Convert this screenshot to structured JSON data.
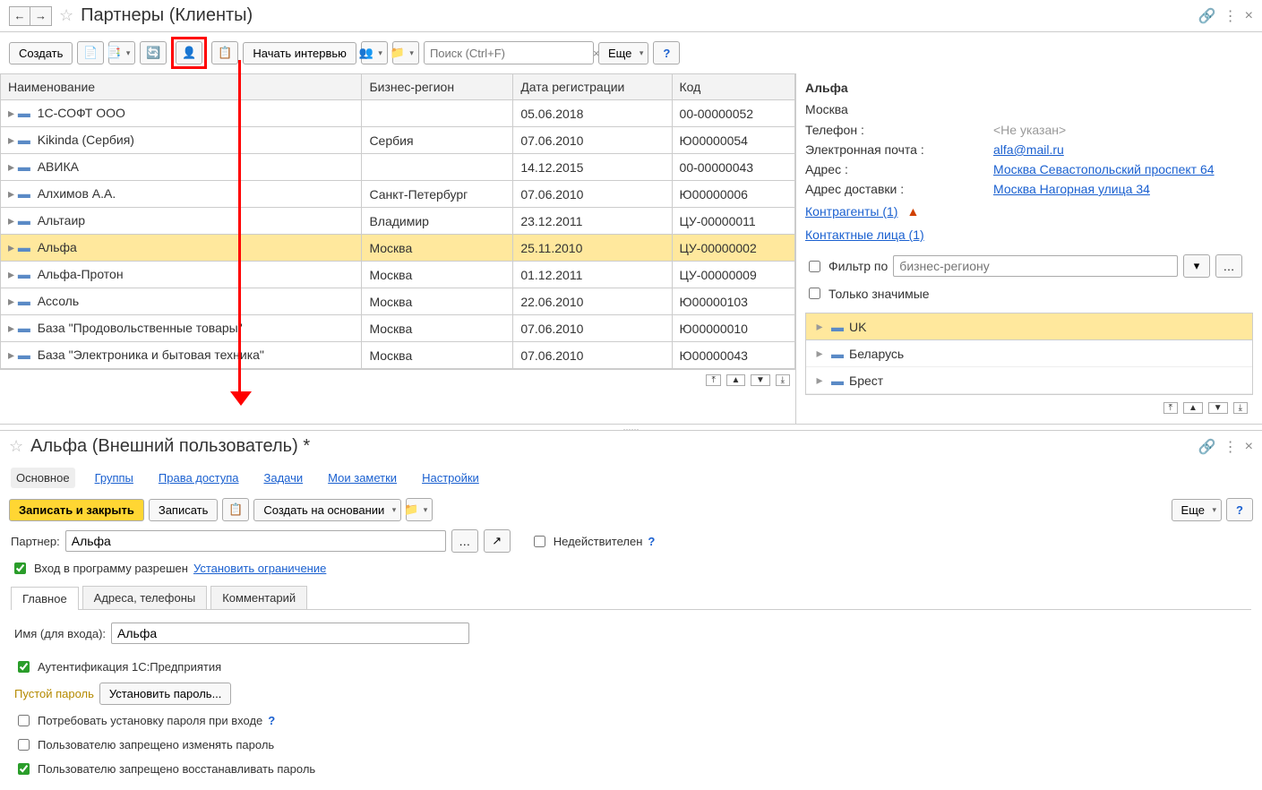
{
  "header": {
    "title": "Партнеры (Клиенты)"
  },
  "toolbar": {
    "create": "Создать",
    "start_interview": "Начать интервью",
    "search_placeholder": "Поиск (Ctrl+F)",
    "more": "Еще",
    "help": "?"
  },
  "columns": {
    "name": "Наименование",
    "region": "Бизнес-регион",
    "date": "Дата регистрации",
    "code": "Код"
  },
  "rows": [
    {
      "name": "1С-СОФТ ООО",
      "region": "",
      "date": "05.06.2018",
      "code": "00-00000052"
    },
    {
      "name": "Kikinda (Сербия)",
      "region": "Сербия",
      "date": "07.06.2010",
      "code": "Ю00000054"
    },
    {
      "name": "АВИКА",
      "region": "",
      "date": "14.12.2015",
      "code": "00-00000043"
    },
    {
      "name": "Алхимов А.А.",
      "region": "Санкт-Петербург",
      "date": "07.06.2010",
      "code": "Ю00000006"
    },
    {
      "name": "Альтаир",
      "region": "Владимир",
      "date": "23.12.2011",
      "code": "ЦУ-00000011"
    },
    {
      "name": "Альфа",
      "region": "Москва",
      "date": "25.11.2010",
      "code": "ЦУ-00000002",
      "selected": true
    },
    {
      "name": "Альфа-Протон",
      "region": "Москва",
      "date": "01.12.2011",
      "code": "ЦУ-00000009"
    },
    {
      "name": "Ассоль",
      "region": "Москва",
      "date": "22.06.2010",
      "code": "Ю00000103"
    },
    {
      "name": "База \"Продовольственные товары\"",
      "region": "Москва",
      "date": "07.06.2010",
      "code": "Ю00000010"
    },
    {
      "name": "База \"Электроника и бытовая техника\"",
      "region": "Москва",
      "date": "07.06.2010",
      "code": "Ю00000043"
    }
  ],
  "side": {
    "name": "Альфа",
    "city": "Москва",
    "phone_lbl": "Телефон :",
    "phone_val": "<Не указан>",
    "email_lbl": "Электронная почта :",
    "email_val": "alfa@mail.ru",
    "addr_lbl": "Адрес :",
    "addr_val": "Москва Севастопольский проспект 64",
    "deliv_lbl": "Адрес доставки :",
    "deliv_val": "Москва Нагорная улица 34",
    "contractors": "Контрагенты (1)",
    "contacts": "Контактные лица (1)",
    "filter_lbl": "Фильтр по",
    "filter_placeholder": "бизнес-региону",
    "only_sig": "Только значимые",
    "regions": [
      "UK",
      "Беларусь",
      "Брест"
    ]
  },
  "form": {
    "title": "Альфа (Внешний пользователь) *",
    "tabs": [
      "Основное",
      "Группы",
      "Права доступа",
      "Задачи",
      "Мои заметки",
      "Настройки"
    ],
    "save_close": "Записать и закрыть",
    "save": "Записать",
    "create_from": "Создать на основании",
    "more": "Еще",
    "partner_lbl": "Партнер:",
    "partner_val": "Альфа",
    "inactive": "Недействителен",
    "login_allowed": "Вход в программу разрешен",
    "set_restriction": "Установить ограничение",
    "subtabs": [
      "Главное",
      "Адреса, телефоны",
      "Комментарий"
    ],
    "name_lbl": "Имя (для входа):",
    "name_val": "Альфа",
    "auth_1c": "Аутентификация 1С:Предприятия",
    "empty_pw": "Пустой пароль",
    "set_pw": "Установить пароль...",
    "req_pw": "Потребовать установку пароля при входе",
    "no_change": "Пользователю запрещено изменять пароль",
    "no_restore": "Пользователю запрещено восстанавливать пароль"
  }
}
